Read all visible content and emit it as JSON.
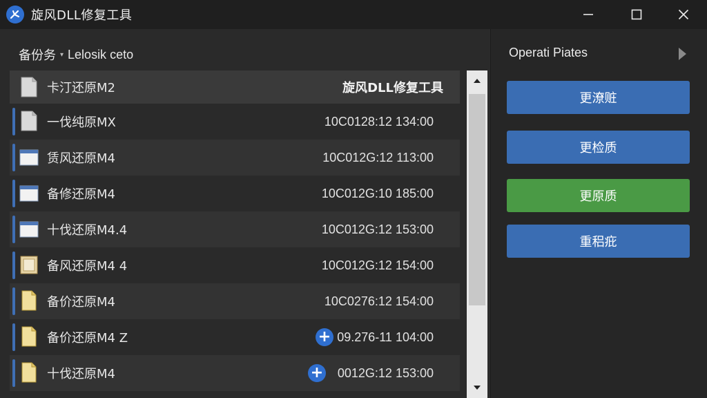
{
  "window": {
    "title": "旋风DLL修复工具",
    "icon": "app-fan-icon",
    "controls": [
      "minimize-icon",
      "maximize-icon",
      "close-icon"
    ]
  },
  "breadcrumb": {
    "root": "备份务",
    "separator": "▾",
    "path": "Lelosik ceto"
  },
  "file_list": {
    "header": {
      "name": "卡汀还原M2",
      "column": "旋风DLL修复工具"
    },
    "rows": [
      {
        "name": "一伐纯原MX",
        "date": "10C0128:12 134:00",
        "icon": "document-icon"
      },
      {
        "name": "赁风还原M4",
        "date": "10C012G:12 113:00",
        "icon": "window-icon"
      },
      {
        "name": "备修还原M4",
        "date": "10C012G:10 185:00",
        "icon": "window-icon"
      },
      {
        "name": "十伐还原M4.4",
        "date": "10C012G:12 153:00",
        "icon": "window-icon"
      },
      {
        "name": "备风还原M4 4",
        "date": "10C012G:12 154:00",
        "icon": "image-icon"
      },
      {
        "name": "备价还原M4",
        "date": "10C0276:12 154:00",
        "icon": "file-icon"
      },
      {
        "name": "备价还原M4 Z",
        "date": "09.276-11 104:00",
        "icon": "file-icon",
        "badge": "+"
      },
      {
        "name": "十伐还原M4",
        "date": "0012G:12 153:00",
        "icon": "file-icon",
        "badge": "+"
      }
    ]
  },
  "scrollbar": {
    "up": "▲",
    "down": "▼"
  },
  "operations": {
    "title": "Operati Piates",
    "arrow": "chevron-right-icon",
    "buttons": [
      {
        "label": "更潦赃",
        "color": "#3a6db3"
      },
      {
        "label": "更检质",
        "color": "#3a6db3"
      },
      {
        "label": "更原质",
        "color": "#4a9a45"
      },
      {
        "label": "重稆疪",
        "color": "#3a6db3"
      }
    ]
  },
  "colors": {
    "accent_blue": "#3a6db3",
    "accent_green": "#4a9a45",
    "titlebar": "#1f1f1f",
    "panel": "#2a2a2a"
  }
}
